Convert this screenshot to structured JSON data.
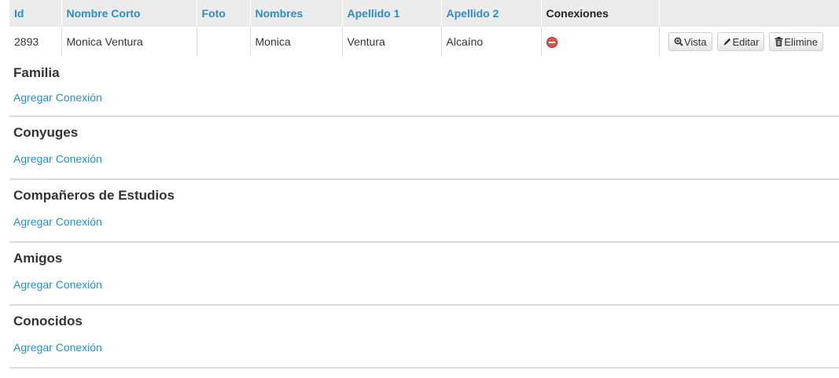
{
  "table": {
    "headers": {
      "id": "Id",
      "nombre_corto": "Nombre Corto",
      "foto": "Foto",
      "nombres": "Nombres",
      "apellido1": "Apellido 1",
      "apellido2": "Apellido 2",
      "conexiones": "Conexiones"
    },
    "row": {
      "id": "2893",
      "nombre_corto": "Monica Ventura",
      "foto": "",
      "nombres": "Monica",
      "apellido1": "Ventura",
      "apellido2": "Alcaíno",
      "conexiones_icon": "minus-circle-icon"
    },
    "actions": {
      "view_label": "Vista",
      "edit_label": "Editar",
      "delete_label": "Elimine"
    }
  },
  "sections": [
    {
      "title": "Familia",
      "link": "Agregar Conexión"
    },
    {
      "title": "Conyuges",
      "link": "Agregar Conexión"
    },
    {
      "title": "Compañeros de Estudios",
      "link": "Agregar Conexión"
    },
    {
      "title": "Amigos",
      "link": "Agregar Conexión"
    },
    {
      "title": "Conocidos",
      "link": "Agregar Conexión"
    }
  ],
  "colors": {
    "link": "#2a8fc7",
    "header_bg": "#ebebeb",
    "status_red": "#d9534f",
    "divider": "#dddddd"
  }
}
